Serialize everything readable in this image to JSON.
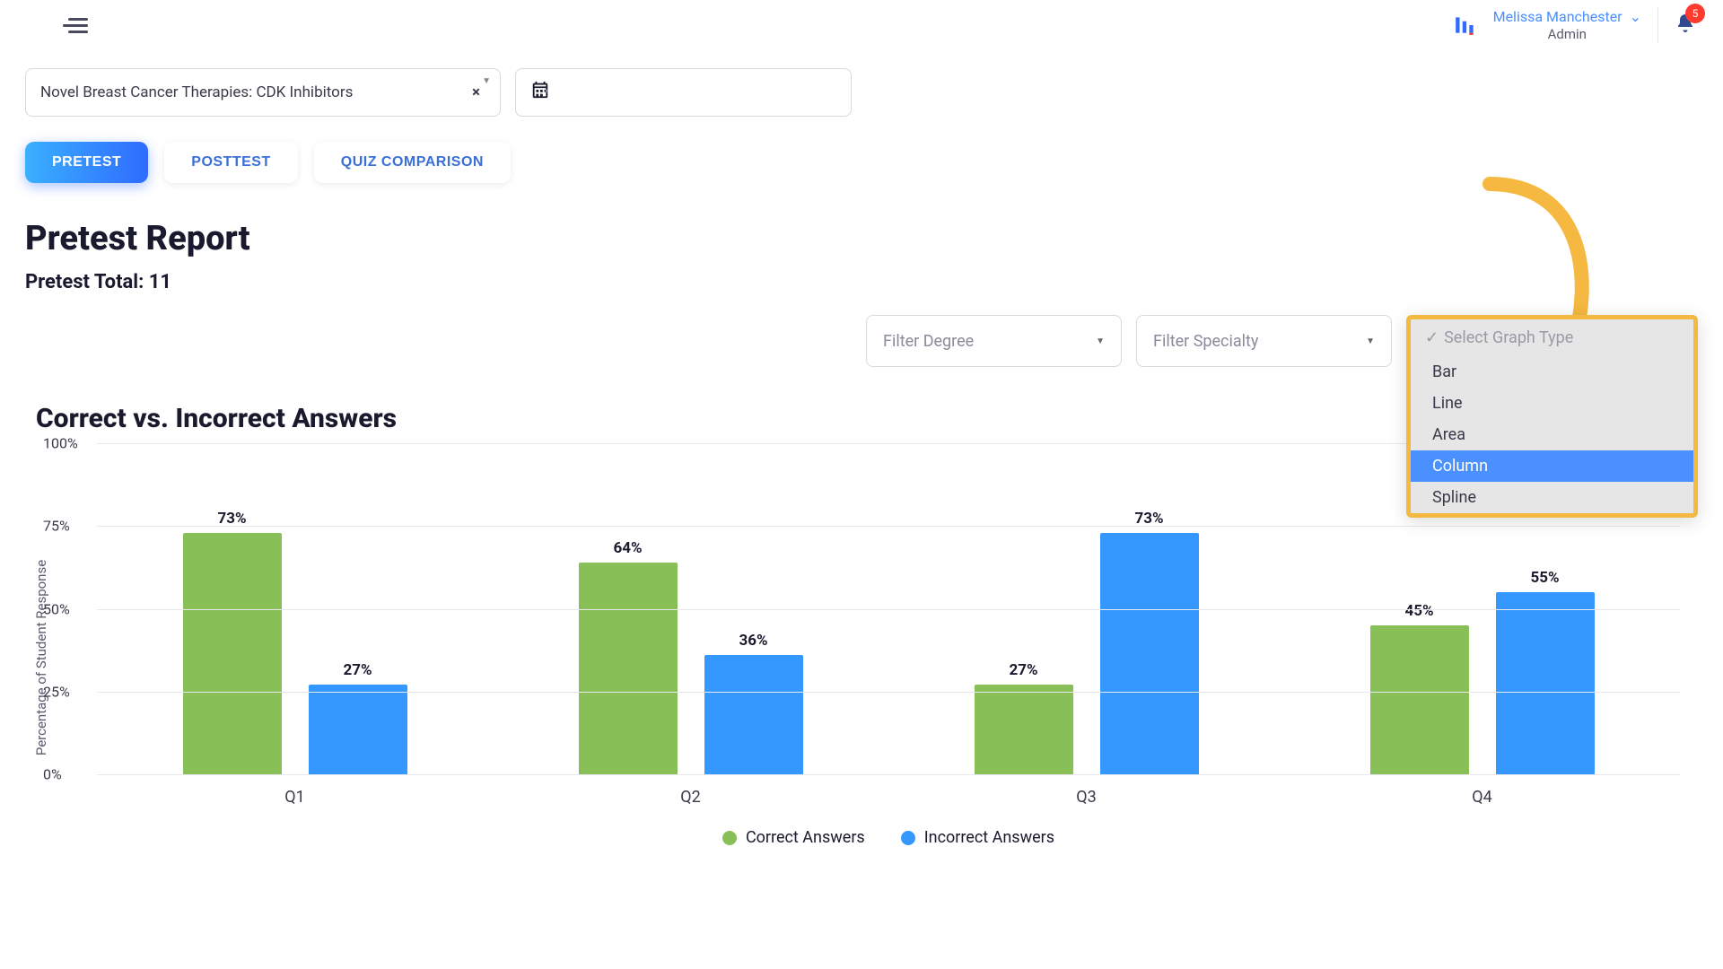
{
  "header": {
    "user_name": "Melissa Manchester",
    "user_role": "Admin",
    "notification_count": "5"
  },
  "filters": {
    "course": "Novel Breast Cancer Therapies: CDK Inhibitors"
  },
  "tabs": {
    "pretest": "PRETEST",
    "posttest": "POSTTEST",
    "quiz_comparison": "QUIZ COMPARISON"
  },
  "page": {
    "title": "Pretest Report",
    "subtitle": "Pretest Total: 11",
    "filter_degree_placeholder": "Filter Degree",
    "filter_specialty_placeholder": "Filter Specialty"
  },
  "graph_type_dropdown": {
    "placeholder": "Select Graph Type",
    "options": [
      "Bar",
      "Line",
      "Area",
      "Column",
      "Spline"
    ],
    "selected": "Column"
  },
  "chart": {
    "title": "Correct vs. Incorrect Answers",
    "y_axis_label": "Percentage of Student Response",
    "legend_correct": "Correct Answers",
    "legend_incorrect": "Incorrect Answers"
  },
  "chart_data": {
    "type": "bar",
    "categories": [
      "Q1",
      "Q2",
      "Q3",
      "Q4"
    ],
    "series": [
      {
        "name": "Correct Answers",
        "values": [
          73,
          64,
          27,
          45
        ],
        "color": "#88c057"
      },
      {
        "name": "Incorrect Answers",
        "values": [
          27,
          36,
          73,
          55
        ],
        "color": "#3498ff"
      }
    ],
    "title": "Correct vs. Incorrect Answers",
    "xlabel": "",
    "ylabel": "Percentage of Student Response",
    "ylim": [
      0,
      100
    ],
    "y_ticks": [
      0,
      25,
      50,
      75,
      100
    ],
    "y_tick_format": "%"
  }
}
